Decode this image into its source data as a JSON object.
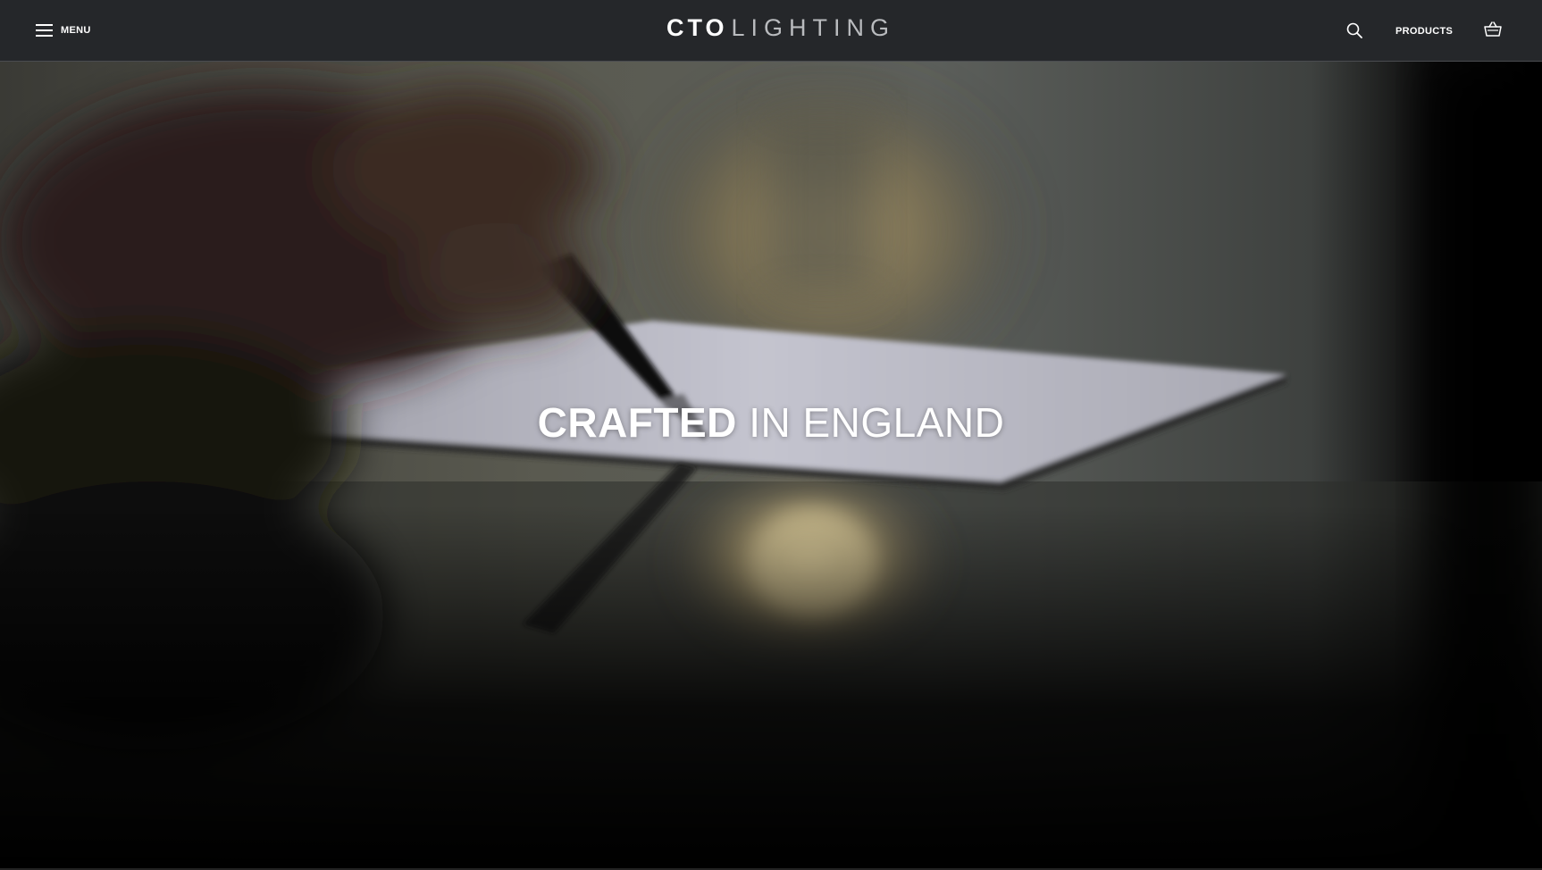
{
  "header": {
    "menu_label": "MENU",
    "menu_icon": "hamburger-icon",
    "logo": {
      "bold_part": "CTO",
      "light_part": "LIGHTING"
    },
    "search_icon": "search-icon",
    "products_label": "PRODUCTS",
    "basket_icon": "basket-icon"
  },
  "hero": {
    "headline_strong": "CRAFTED",
    "headline_rest": "IN ENGLAND",
    "image_description_icon": "hero-background-image"
  },
  "colors": {
    "header_bg": "#25272a",
    "text": "#ffffff",
    "logo_light": "#b9bbbe"
  }
}
